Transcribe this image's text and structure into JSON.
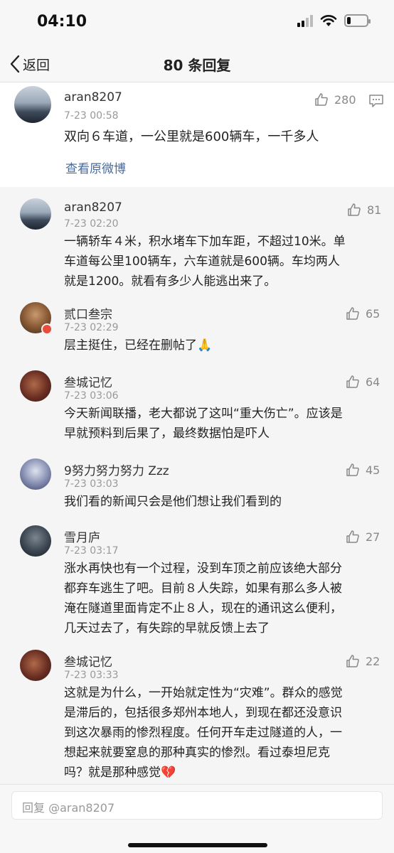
{
  "status_bar": {
    "time": "04:10",
    "battery_level": 0.2
  },
  "nav": {
    "back_label": "返回",
    "title": "80 条回复"
  },
  "main_comment": {
    "username": "aran8207",
    "time": "7-23 00:58",
    "likes": "280",
    "content": "双向６车道，一公里就是600辆车，一千多人",
    "view_original": "查看原微博"
  },
  "replies": [
    {
      "username": "aran8207",
      "time": "7-23 02:20",
      "likes": "81",
      "lines": [
        "一辆轿车４米，积水堵车下加车距，不超过10米。单",
        "车道每公里100辆车，六车道就是600辆。车均两人",
        "就是1200。就看有多少人能逃出来了。"
      ]
    },
    {
      "username": "贰口叁宗",
      "time": "7-23 02:29",
      "likes": "65",
      "lines": [
        "层主挺住，已经在删帖了🙏"
      ]
    },
    {
      "username": "叁城记忆",
      "time": "7-23 03:06",
      "likes": "64",
      "lines": [
        "今天新闻联播，老大都说了这叫“重大伤亡”。应该是",
        "早就预料到后果了，最终数据怕是吓人"
      ]
    },
    {
      "username": "9努力努力努力 Zzz",
      "time": "7-23 03:03",
      "likes": "45",
      "lines": [
        "我们看的新闻只会是他们想让我们看到的"
      ]
    },
    {
      "username": "雪月庐",
      "time": "7-23 03:17",
      "likes": "27",
      "lines": [
        "涨水再快也有一个过程，没到车顶之前应该绝大部分",
        "都弃车逃生了吧。目前８人失踪，如果有那么多人被",
        "淹在隧道里面肯定不止８人，现在的通讯这么便利，",
        "几天过去了，有失踪的早就反馈上去了"
      ]
    },
    {
      "username": "叁城记忆",
      "time": "7-23 03:33",
      "likes": "22",
      "lines": [
        "这就是为什么，一开始就定性为“灾难”。群众的感觉",
        "是滞后的，包括很多郑州本地人，到现在都还没意识",
        "到这次暴雨的惨烈程度。任何开车走过隧道的人，一",
        "想起来就要窒息的那种真实的惨烈。看过泰坦尼克",
        "吗？就是那种感觉💔"
      ]
    }
  ],
  "reply_input": {
    "placeholder": "回复 @aran8207"
  }
}
